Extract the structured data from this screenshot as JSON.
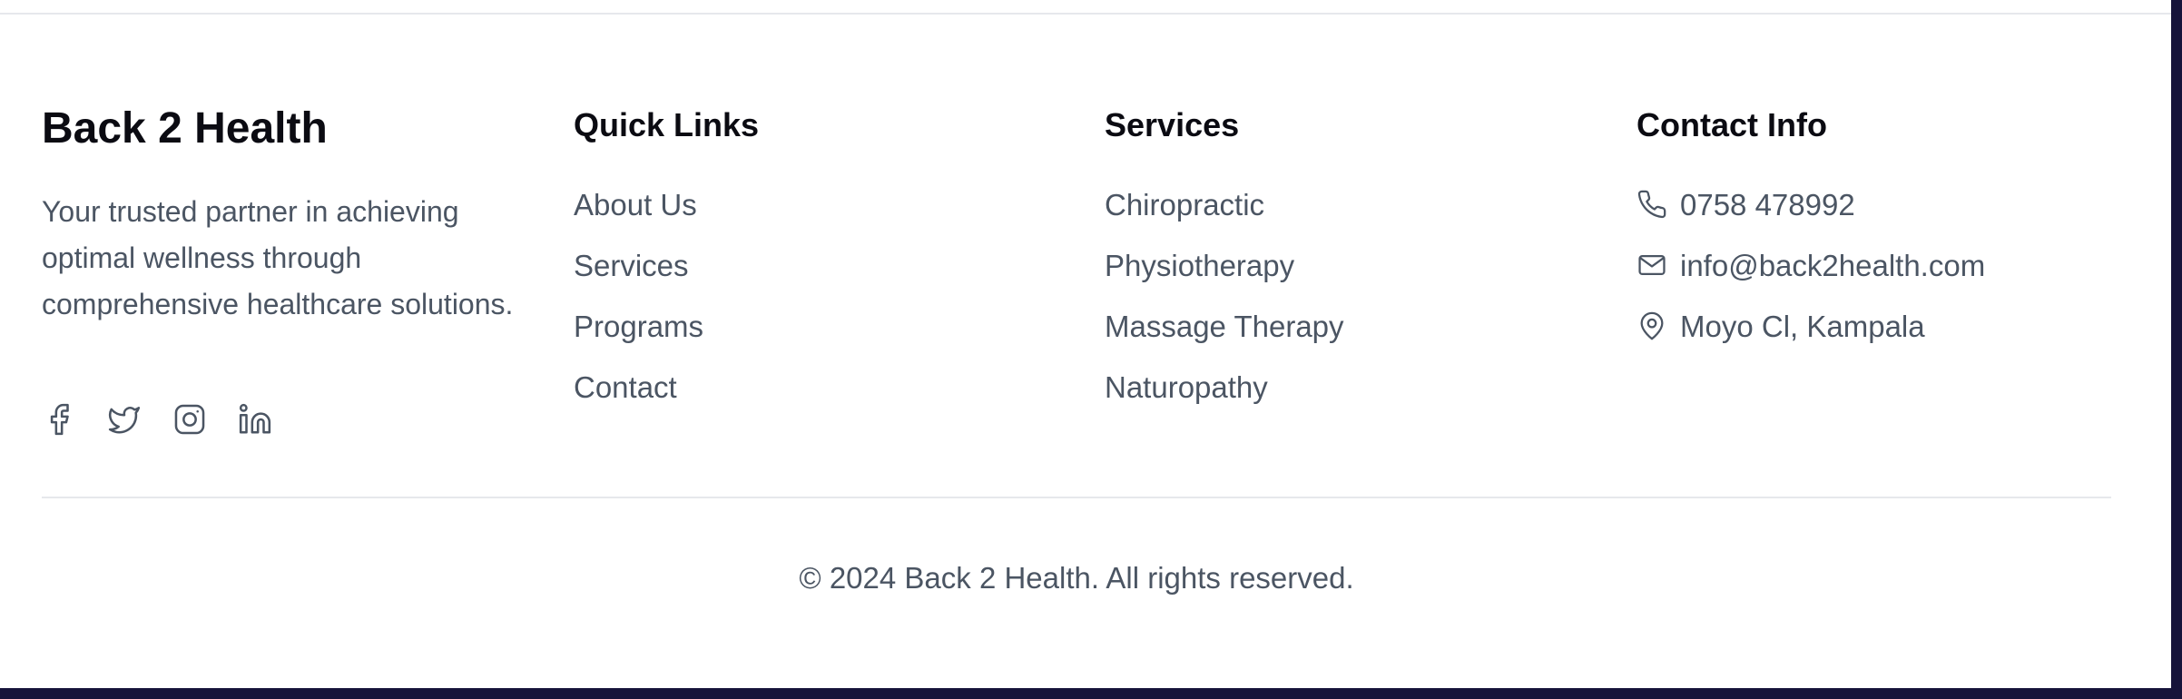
{
  "brand": {
    "title": "Back 2 Health",
    "tagline": "Your trusted partner in achieving optimal wellness through comprehensive healthcare solutions.",
    "socials": [
      "facebook-icon",
      "twitter-icon",
      "instagram-icon",
      "linkedin-icon"
    ]
  },
  "quick_links": {
    "heading": "Quick Links",
    "items": [
      "About Us",
      "Services",
      "Programs",
      "Contact"
    ]
  },
  "services": {
    "heading": "Services",
    "items": [
      "Chiropractic",
      "Physiotherapy",
      "Massage Therapy",
      "Naturopathy"
    ]
  },
  "contact": {
    "heading": "Contact Info",
    "phone": "0758 478992",
    "email": "info@back2health.com",
    "address": "Moyo Cl, Kampala"
  },
  "footer": {
    "copyright": "© 2024 Back 2 Health. All rights reserved."
  },
  "colors": {
    "text_muted": "#4b5563",
    "heading": "#0b0b12",
    "divider": "#e6e8ec",
    "frame": "#16133a"
  }
}
